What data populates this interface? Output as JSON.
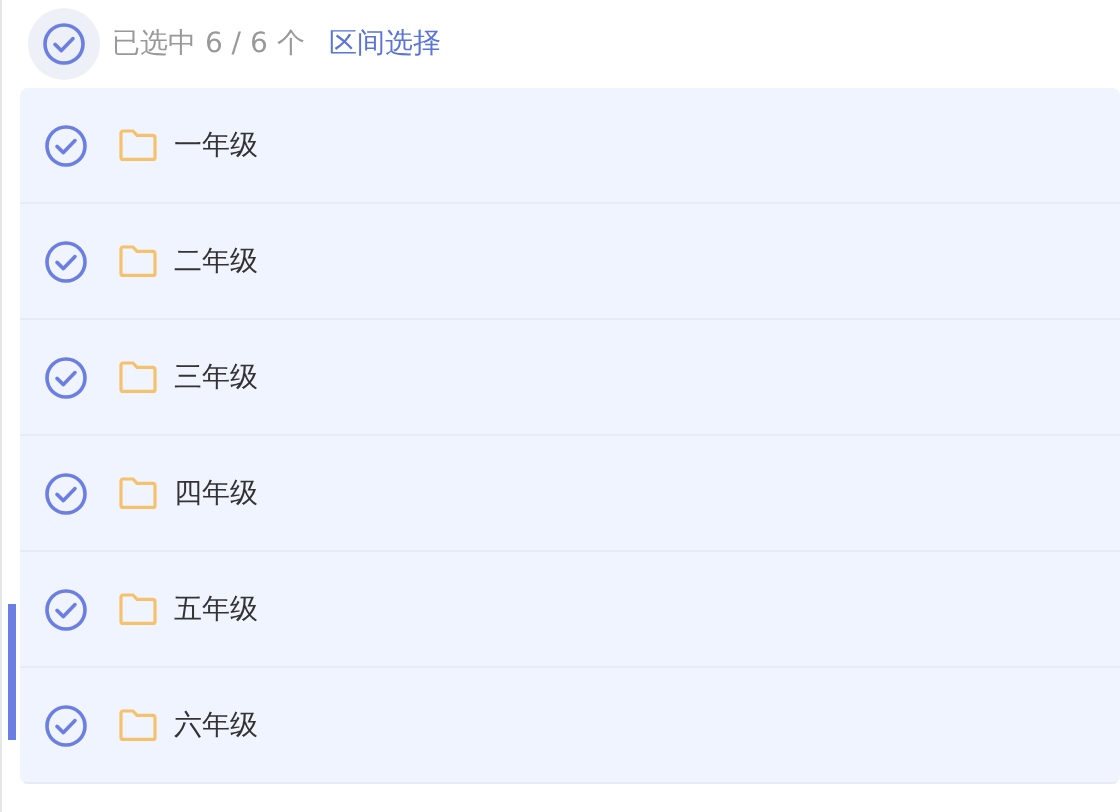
{
  "header": {
    "select_all_checked": true,
    "count_text": "已选中 6 / 6 个",
    "range_link": "区间选择"
  },
  "items": [
    {
      "label": "一年级",
      "checked": true
    },
    {
      "label": "二年级",
      "checked": true
    },
    {
      "label": "三年级",
      "checked": true
    },
    {
      "label": "四年级",
      "checked": true
    },
    {
      "label": "五年级",
      "checked": true
    },
    {
      "label": "六年级",
      "checked": true
    }
  ]
}
